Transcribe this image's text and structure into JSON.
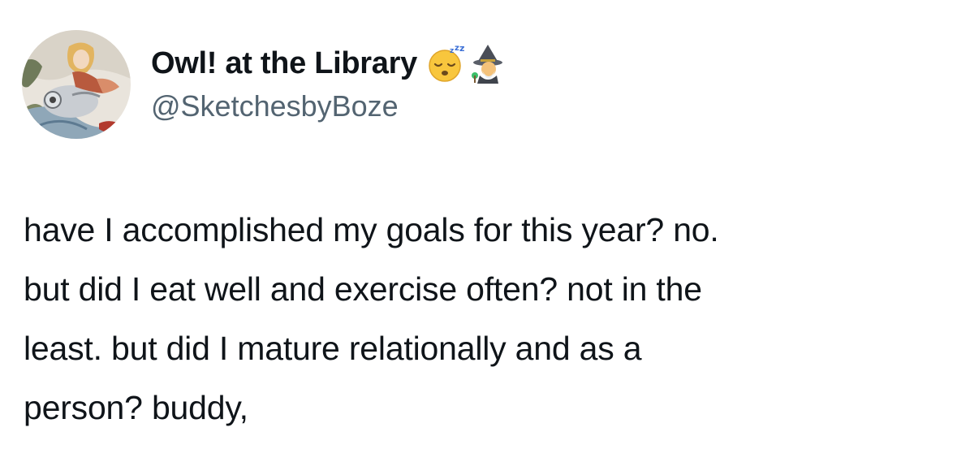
{
  "user": {
    "display_name": "Owl! at the Library",
    "handle": "@SketchesbyBoze",
    "name_emojis": [
      "sleeping-face-emoji",
      "mage-emoji"
    ],
    "avatar": "illustrated-girl-with-owl-avatar"
  },
  "tweet": {
    "lines": [
      "have I accomplished my goals for this year? no.",
      "but did I eat well and exercise often? not in the",
      "least. but did I mature relationally and as a",
      "person? buddy,"
    ]
  },
  "colors": {
    "text": "#0f1419",
    "secondary_text": "#536471",
    "background": "#ffffff"
  }
}
